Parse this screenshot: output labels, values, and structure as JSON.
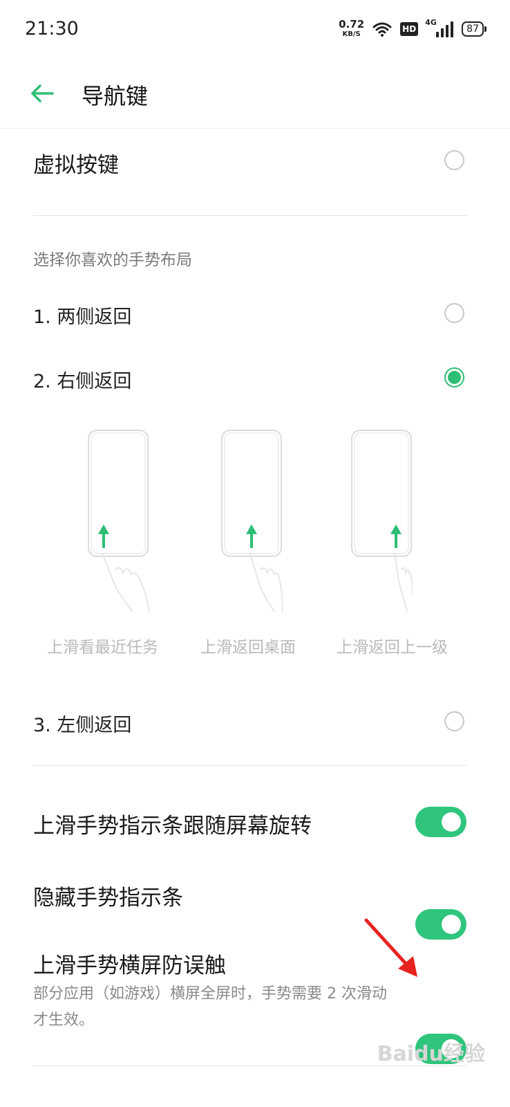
{
  "status_bar": {
    "time": "21:30",
    "net_speed_value": "0.72",
    "net_speed_unit": "KB/S",
    "hd": "HD",
    "network": "4G",
    "battery": "87"
  },
  "header": {
    "back_icon": "arrow-left-icon",
    "title": "导航键",
    "accent_color": "#2dbe74"
  },
  "virtual_keys": {
    "label": "虚拟按键",
    "selected": false
  },
  "gesture_section": {
    "hint": "选择你喜欢的手势布局",
    "options": [
      {
        "label": "1. 两侧返回",
        "selected": false
      },
      {
        "label": "2. 右侧返回",
        "selected": true
      },
      {
        "label": "3. 左侧返回",
        "selected": false
      }
    ],
    "illustrations": [
      {
        "caption": "上滑看最近任务"
      },
      {
        "caption": "上滑返回桌面"
      },
      {
        "caption": "上滑返回上一级"
      }
    ]
  },
  "toggles": [
    {
      "label": "上滑手势指示条跟随屏幕旋转",
      "on": true
    },
    {
      "label": "隐藏手势指示条",
      "on": true
    },
    {
      "label": "上滑手势横屏防误触",
      "description": "部分应用（如游戏）横屏全屏时，手势需要 2 次滑动才生效。",
      "on": true
    }
  ],
  "watermark": "Baidu经验"
}
